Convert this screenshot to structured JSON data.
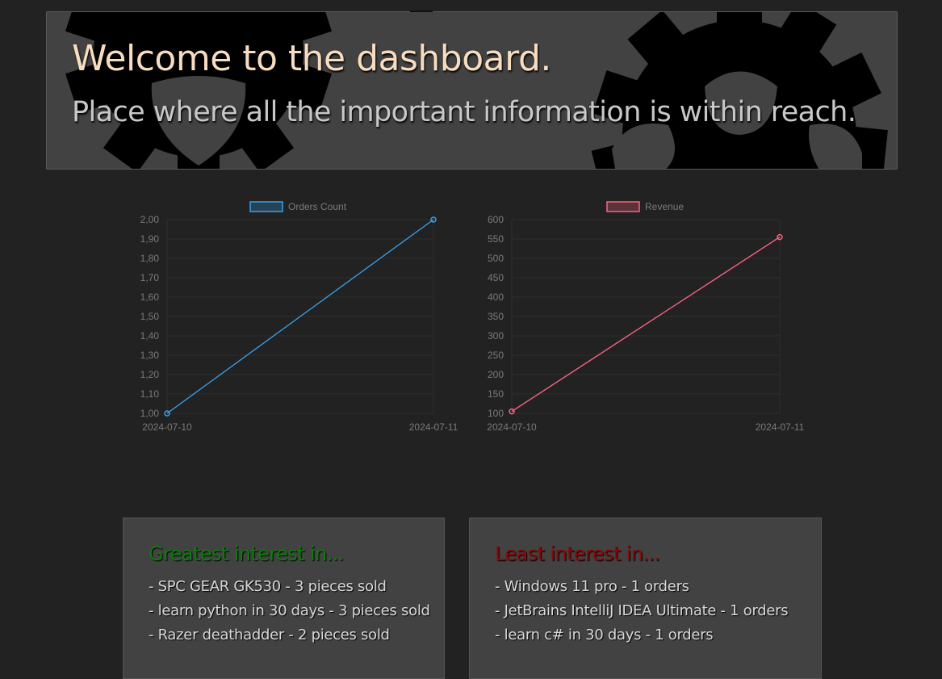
{
  "header": {
    "title": "Welcome to the dashboard.",
    "subtitle": "Place where all the important information is within reach."
  },
  "chart_data": [
    {
      "type": "line",
      "x": [
        "2024-07-10",
        "2024-07-11"
      ],
      "series": [
        {
          "name": "Orders Count",
          "values": [
            1.0,
            2.0
          ],
          "color": "#36a2eb"
        }
      ],
      "y_ticks": [
        "2,00",
        "1,90",
        "1,80",
        "1,70",
        "1,60",
        "1,50",
        "1,40",
        "1,30",
        "1,20",
        "1,10",
        "1,00"
      ],
      "ylim": [
        1.0,
        2.0
      ],
      "legend": "top",
      "grid": true
    },
    {
      "type": "line",
      "x": [
        "2024-07-10",
        "2024-07-11"
      ],
      "series": [
        {
          "name": "Revenue",
          "values": [
            105,
            555
          ],
          "color": "#ff6384"
        }
      ],
      "y_ticks": [
        "600",
        "550",
        "500",
        "450",
        "400",
        "350",
        "300",
        "250",
        "200",
        "150",
        "100"
      ],
      "ylim": [
        100,
        600
      ],
      "legend": "top",
      "grid": true
    }
  ],
  "greatest": {
    "title": "Greatest interest in...",
    "title_color": "#0f7a0f",
    "items": [
      "- SPC GEAR GK530 - 3 pieces sold",
      "- learn python in 30 days - 3 pieces sold",
      "- Razer deathadder - 2 pieces sold"
    ]
  },
  "least": {
    "title": "Least interest in...",
    "title_color": "#8b0a0a",
    "items": [
      "- Windows 11 pro - 1 orders",
      "- JetBrains IntelliJ IDEA Ultimate - 1 orders",
      "- learn c# in 30 days - 1 orders"
    ]
  }
}
